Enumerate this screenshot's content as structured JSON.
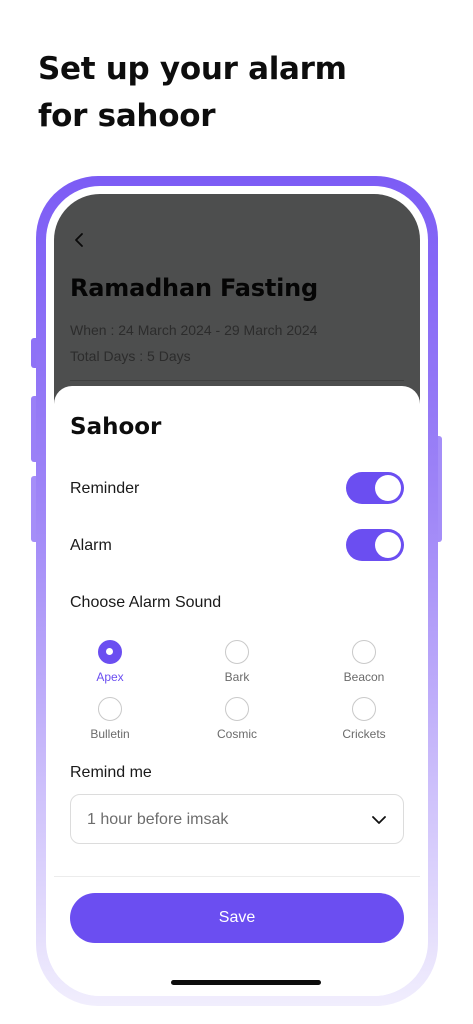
{
  "headline": {
    "line1": "Set up your alarm",
    "line2": "for sahoor"
  },
  "background_screen": {
    "back_icon": "chevron-left-icon",
    "title": "Ramadhan Fasting",
    "when": "When : 24 March 2024 - 29 March 2024",
    "total_days": "Total Days : 5 Days"
  },
  "sheet": {
    "title": "Sahoor",
    "reminder": {
      "label": "Reminder",
      "on": true
    },
    "alarm": {
      "label": "Alarm",
      "on": true
    },
    "choose_sound_label": "Choose Alarm Sound",
    "sounds": [
      {
        "label": "Apex",
        "selected": true
      },
      {
        "label": "Bark",
        "selected": false
      },
      {
        "label": "Beacon",
        "selected": false
      },
      {
        "label": "Bulletin",
        "selected": false
      },
      {
        "label": "Cosmic",
        "selected": false
      },
      {
        "label": "Crickets",
        "selected": false
      }
    ],
    "remind_me_label": "Remind me",
    "remind_me_value": "1 hour before imsak",
    "dropdown_icon": "chevron-down-icon",
    "save_label": "Save"
  },
  "colors": {
    "accent": "#6b4ef1",
    "frame_top": "#7c5cf5",
    "frame_bottom": "#f1eefd",
    "overlay": "#4d4e4e"
  }
}
